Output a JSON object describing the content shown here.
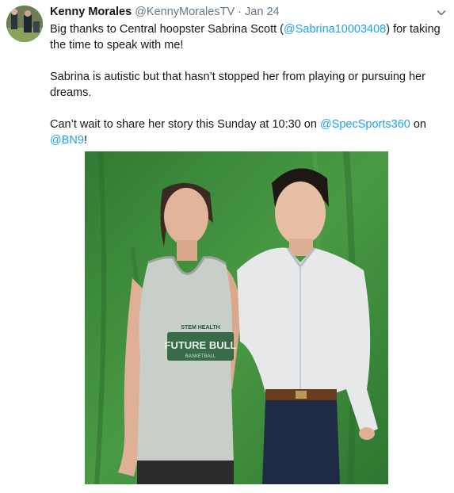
{
  "tweet": {
    "name": "Kenny Morales",
    "handle": "@KennyMoralesTV",
    "dot": "·",
    "date": "Jan 24",
    "para1": {
      "pre": "Big thanks to Central hoopster Sabrina Scott (",
      "mention": "@Sabrina10003408",
      "post": ") for taking the time to speak with me!"
    },
    "para2": "Sabrina is autistic but that hasn’t stopped her from playing or pursuing her dreams.",
    "para3": {
      "pre": "Can’t wait to share her story this Sunday at 10:30 on ",
      "mention1": "@SpecSports360",
      "mid": " on ",
      "mention2": "@BN9",
      "post": "!"
    },
    "jersey_text": {
      "top": "STEM HEALTH",
      "main": "FUTURE BULL",
      "sub": "BASKETBALL"
    }
  },
  "colors": {
    "link": "#1da1f2",
    "muted": "#657786",
    "green_screen": "#3f8d3b"
  },
  "icons": {
    "menu": "chevron-down-icon"
  }
}
